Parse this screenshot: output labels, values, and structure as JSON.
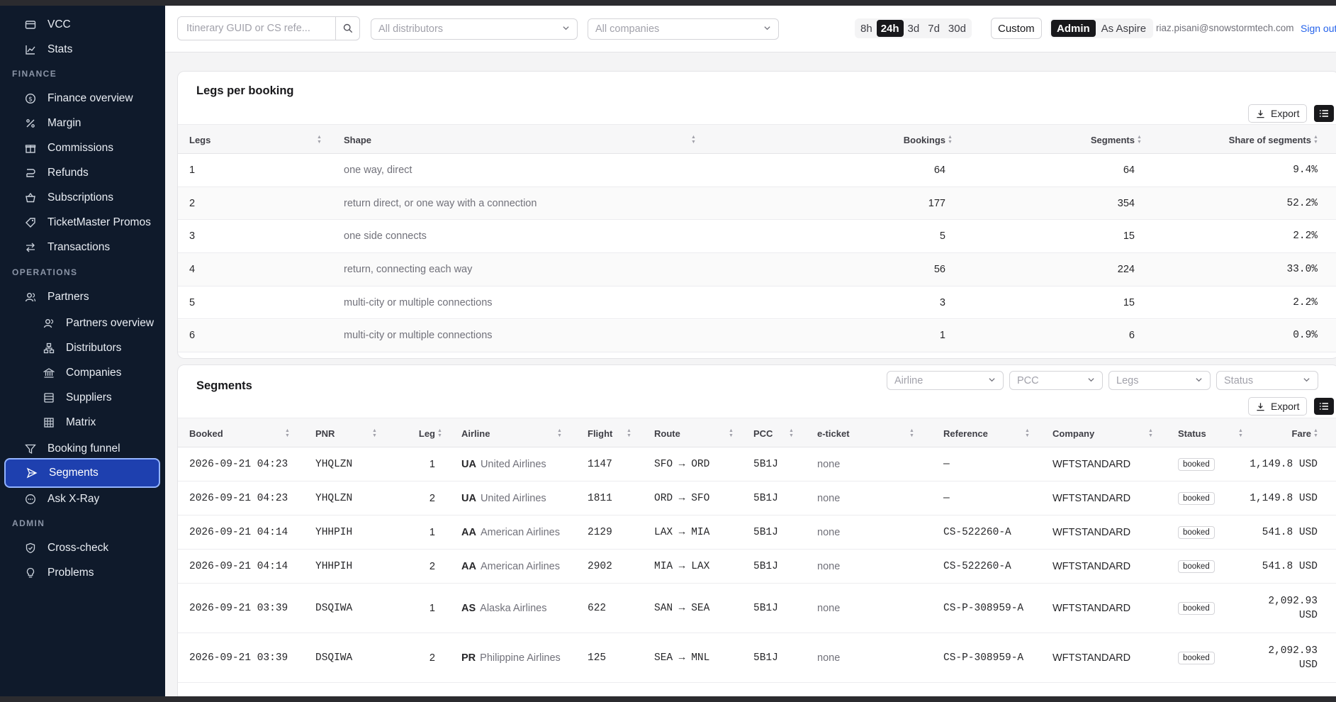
{
  "sidebar": {
    "top_items": [
      {
        "label": "VCC",
        "icon": "card-icon"
      },
      {
        "label": "Stats",
        "icon": "chart-icon"
      }
    ],
    "sections": {
      "finance": "FINANCE",
      "operations": "OPERATIONS",
      "admin": "ADMIN"
    },
    "finance_items": [
      {
        "label": "Finance overview",
        "icon": "dollar-icon"
      },
      {
        "label": "Margin",
        "icon": "percent-icon"
      },
      {
        "label": "Commissions",
        "icon": "gift-icon"
      },
      {
        "label": "Refunds",
        "icon": "refund-icon"
      },
      {
        "label": "Subscriptions",
        "icon": "basket-icon"
      },
      {
        "label": "TicketMaster Promos",
        "icon": "tag-icon"
      },
      {
        "label": "Transactions",
        "icon": "arrows-icon"
      }
    ],
    "operations_items": [
      {
        "label": "Partners",
        "icon": "users-icon"
      },
      {
        "label": "Partners overview",
        "icon": "users-icon"
      },
      {
        "label": "Distributors",
        "icon": "network-icon"
      },
      {
        "label": "Companies",
        "icon": "bank-icon"
      },
      {
        "label": "Suppliers",
        "icon": "server-icon"
      },
      {
        "label": "Matrix",
        "icon": "grid-icon"
      },
      {
        "label": "Booking funnel",
        "icon": "funnel-icon"
      },
      {
        "label": "Segments",
        "icon": "send-icon"
      },
      {
        "label": "Ask X-Ray",
        "icon": "chat-icon"
      }
    ],
    "admin_items": [
      {
        "label": "Cross-check",
        "icon": "check-circle-icon"
      },
      {
        "label": "Problems",
        "icon": "bulb-icon"
      }
    ]
  },
  "topbar": {
    "search_placeholder": "Itinerary GUID or CS refe...",
    "distributors_placeholder": "All distributors",
    "companies_placeholder": "All companies",
    "ranges": [
      "8h",
      "24h",
      "3d",
      "7d",
      "30d"
    ],
    "active_range": "24h",
    "custom_label": "Custom",
    "roles": [
      "Admin",
      "As Aspire"
    ],
    "active_role": "Admin",
    "email": "riaz.pisani@snowstormtech.com",
    "signout": "Sign out"
  },
  "legs_card": {
    "title": "Legs per booking",
    "export_label": "Export",
    "columns": [
      "Legs",
      "Shape",
      "Bookings",
      "Segments",
      "Share of segments"
    ],
    "rows": [
      {
        "legs": "1",
        "shape": "one way, direct",
        "bookings": "64",
        "segments": "64",
        "share": "9.4%"
      },
      {
        "legs": "2",
        "shape": "return direct, or one way with a connection",
        "bookings": "177",
        "segments": "354",
        "share": "52.2%"
      },
      {
        "legs": "3",
        "shape": "one side connects",
        "bookings": "5",
        "segments": "15",
        "share": "2.2%"
      },
      {
        "legs": "4",
        "shape": "return, connecting each way",
        "bookings": "56",
        "segments": "224",
        "share": "33.0%"
      },
      {
        "legs": "5",
        "shape": "multi-city or multiple connections",
        "bookings": "3",
        "segments": "15",
        "share": "2.2%"
      },
      {
        "legs": "6",
        "shape": "multi-city or multiple connections",
        "bookings": "1",
        "segments": "6",
        "share": "0.9%"
      }
    ]
  },
  "segments_card": {
    "title": "Segments",
    "filters": [
      "Airline",
      "PCC",
      "Legs",
      "Status"
    ],
    "export_label": "Export",
    "columns": [
      "Booked",
      "PNR",
      "Leg",
      "Airline",
      "Flight",
      "Route",
      "PCC",
      "e-ticket",
      "Reference",
      "Company",
      "Status",
      "Fare"
    ],
    "rows": [
      {
        "booked": "2026-09-21 04:23",
        "pnr": "YHQLZN",
        "leg": "1",
        "airline_code": "UA",
        "airline_name": "United Airlines",
        "flight": "1147",
        "route": "SFO → ORD",
        "pcc": "5B1J",
        "eticket": "none",
        "reference": "—",
        "company": "WFTSTANDARD",
        "status": "booked",
        "fare": "1,149.8 USD",
        "fare_l1": "1,149.8 USD",
        "fare_l2": ""
      },
      {
        "booked": "2026-09-21 04:23",
        "pnr": "YHQLZN",
        "leg": "2",
        "airline_code": "UA",
        "airline_name": "United Airlines",
        "flight": "1811",
        "route": "ORD → SFO",
        "pcc": "5B1J",
        "eticket": "none",
        "reference": "—",
        "company": "WFTSTANDARD",
        "status": "booked",
        "fare_l1": "1,149.8 USD",
        "fare_l2": ""
      },
      {
        "booked": "2026-09-21 04:14",
        "pnr": "YHHPIH",
        "leg": "1",
        "airline_code": "AA",
        "airline_name": "American Airlines",
        "flight": "2129",
        "route": "LAX → MIA",
        "pcc": "5B1J",
        "eticket": "none",
        "reference": "CS-522260-A",
        "company": "WFTSTANDARD",
        "status": "booked",
        "fare_l1": "541.8 USD",
        "fare_l2": ""
      },
      {
        "booked": "2026-09-21 04:14",
        "pnr": "YHHPIH",
        "leg": "2",
        "airline_code": "AA",
        "airline_name": "American Airlines",
        "flight": "2902",
        "route": "MIA → LAX",
        "pcc": "5B1J",
        "eticket": "none",
        "reference": "CS-522260-A",
        "company": "WFTSTANDARD",
        "status": "booked",
        "fare_l1": "541.8 USD",
        "fare_l2": ""
      },
      {
        "booked": "2026-09-21 03:39",
        "pnr": "DSQIWA",
        "leg": "1",
        "airline_code": "AS",
        "airline_name": "Alaska Airlines",
        "flight": "622",
        "route": "SAN → SEA",
        "pcc": "5B1J",
        "eticket": "none",
        "reference": "CS-P-308959-A",
        "company": "WFTSTANDARD",
        "status": "booked",
        "fare_l1": "2,092.93",
        "fare_l2": "USD"
      },
      {
        "booked": "2026-09-21 03:39",
        "pnr": "DSQIWA",
        "leg": "2",
        "airline_code": "PR",
        "airline_name": "Philippine Airlines",
        "flight": "125",
        "route": "SEA → MNL",
        "pcc": "5B1J",
        "eticket": "none",
        "reference": "CS-P-308959-A",
        "company": "WFTSTANDARD",
        "status": "booked",
        "fare_l1": "2,092.93",
        "fare_l2": "USD"
      }
    ]
  }
}
